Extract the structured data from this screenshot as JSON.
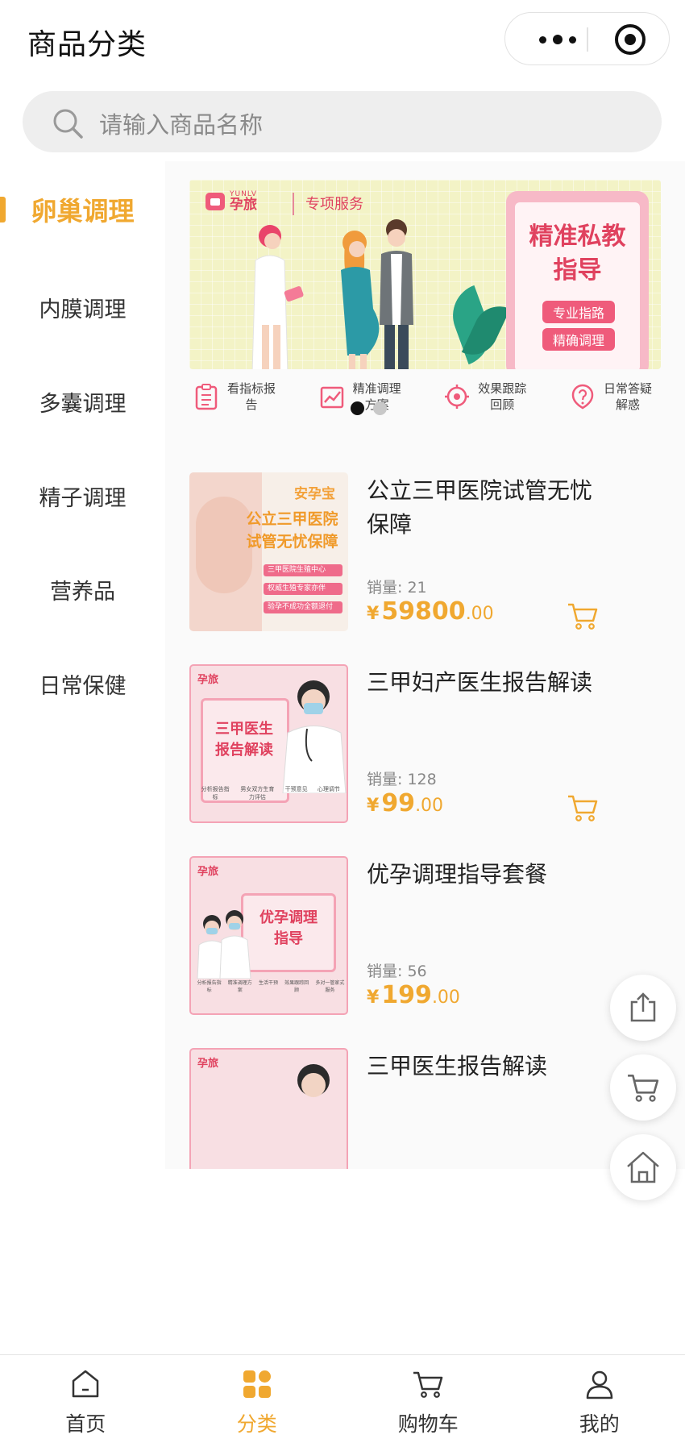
{
  "header": {
    "title": "商品分类",
    "menu_icon": "more-dots-icon",
    "close_icon": "target-icon"
  },
  "search": {
    "placeholder": "请输入商品名称",
    "icon": "search-icon"
  },
  "sidebar": {
    "items": [
      {
        "label": "卵巢调理",
        "active": true
      },
      {
        "label": "内膜调理",
        "active": false
      },
      {
        "label": "多囊调理",
        "active": false
      },
      {
        "label": "精子调理",
        "active": false
      },
      {
        "label": "营养品",
        "active": false
      },
      {
        "label": "日常保健",
        "active": false
      }
    ]
  },
  "banner": {
    "brand": "孕旅",
    "brand_en": "YUNLV",
    "service": "专项服务",
    "headline_1": "精准私教",
    "headline_2": "指导",
    "tag_1": "专业指路",
    "tag_2": "精确调理",
    "features": [
      {
        "label": "看指标报告",
        "icon": "clipboard-icon"
      },
      {
        "label": "精准调理方案",
        "icon": "trend-chart-icon"
      },
      {
        "label": "效果跟踪回顾",
        "icon": "target-tracking-icon"
      },
      {
        "label": "日常答疑解惑",
        "icon": "question-icon"
      }
    ],
    "indicator_active_color": "#111111",
    "indicator_inactive_color": "#c8c8c8"
  },
  "products": [
    {
      "name": "公立三甲医院试管无忧保障",
      "sales_label": "销量: 21",
      "currency": "¥",
      "price_int": "59800",
      "price_dec": ".00",
      "thumb": {
        "brand": "安孕宝",
        "line1": "公立三甲医院",
        "line2": "试管无忧保障",
        "bullets": [
          "三甲医院生殖中心",
          "权威生殖专家亦伴",
          "验孕不成功全额退付"
        ]
      }
    },
    {
      "name": "三甲妇产医生报告解读",
      "sales_label": "销量: 128",
      "currency": "¥",
      "price_int": "99",
      "price_dec": ".00",
      "thumb": {
        "brand": "孕旅",
        "line1": "三甲医生",
        "line2": "报告解读",
        "bullets": [
          "分析报告指标",
          "男女双方生育力评估",
          "干预意见",
          "心理调节"
        ]
      }
    },
    {
      "name": "优孕调理指导套餐",
      "sales_label": "销量: 56",
      "currency": "¥",
      "price_int": "199",
      "price_dec": ".00",
      "thumb": {
        "brand": "孕旅",
        "line1": "优孕调理",
        "line2": "指导",
        "bullets": [
          "分析报告指标",
          "精准调理方案",
          "生活干预",
          "效果跟踪回顾",
          "多对一管家式服务"
        ]
      }
    },
    {
      "name": "三甲医生报告解读",
      "thumb": {
        "brand": "孕旅"
      }
    }
  ],
  "floating": [
    {
      "name": "share-icon"
    },
    {
      "name": "cart-icon"
    },
    {
      "name": "home-icon"
    }
  ],
  "tabbar": {
    "items": [
      {
        "label": "首页",
        "icon": "home-icon",
        "active": false
      },
      {
        "label": "分类",
        "icon": "category-icon",
        "active": true
      },
      {
        "label": "购物车",
        "icon": "cart-icon",
        "active": false
      },
      {
        "label": "我的",
        "icon": "user-icon",
        "active": false
      }
    ]
  },
  "colors": {
    "accent": "#f0a830",
    "brand_pink": "#e0425f"
  }
}
